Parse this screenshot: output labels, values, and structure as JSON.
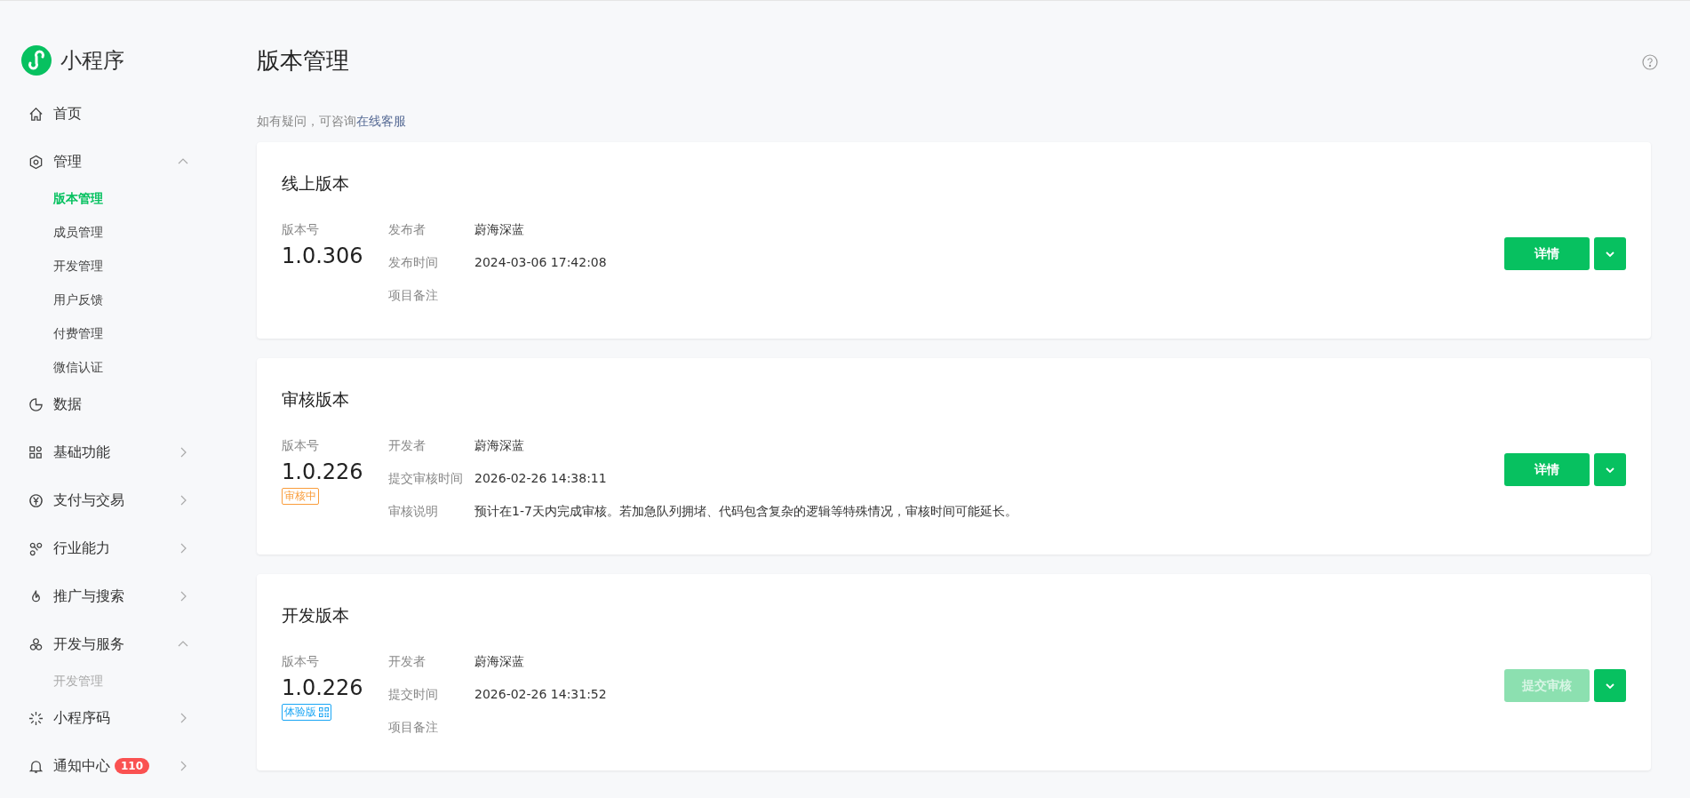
{
  "app": {
    "name": "小程序"
  },
  "sidebar": {
    "items": [
      {
        "label": "首页",
        "kind": "link"
      },
      {
        "label": "管理",
        "kind": "group",
        "expanded": true,
        "children": [
          {
            "label": "版本管理",
            "selected": true,
            "disabled": false
          },
          {
            "label": "成员管理",
            "selected": false,
            "disabled": false
          },
          {
            "label": "开发管理",
            "selected": false,
            "disabled": false
          },
          {
            "label": "用户反馈",
            "selected": false,
            "disabled": false
          },
          {
            "label": "付费管理",
            "selected": false,
            "disabled": false
          },
          {
            "label": "微信认证",
            "selected": false,
            "disabled": false
          }
        ]
      },
      {
        "label": "数据",
        "kind": "link"
      },
      {
        "label": "基础功能",
        "kind": "group",
        "expanded": false
      },
      {
        "label": "支付与交易",
        "kind": "group",
        "expanded": false
      },
      {
        "label": "行业能力",
        "kind": "group",
        "expanded": false
      },
      {
        "label": "推广与搜索",
        "kind": "group",
        "expanded": false
      },
      {
        "label": "开发与服务",
        "kind": "group",
        "expanded": true,
        "children": [
          {
            "label": "开发管理",
            "selected": false,
            "disabled": true
          }
        ]
      },
      {
        "label": "小程序码",
        "kind": "group",
        "expanded": false
      },
      {
        "label": "通知中心",
        "kind": "group",
        "expanded": false,
        "badge": "110"
      }
    ]
  },
  "page": {
    "title": "版本管理",
    "hint": "如有疑问，可咨询",
    "hint_link": "在线客服"
  },
  "cards": [
    {
      "title": "线上版本",
      "version_label": "版本号",
      "version": "1.0.306",
      "fields": [
        {
          "label": "发布者",
          "value": "蔚海深蓝"
        },
        {
          "label": "发布时间",
          "value": "2024-03-06 17:42:08"
        },
        {
          "label": "项目备注"
        }
      ],
      "button": {
        "label": "详情",
        "disabled": false
      }
    },
    {
      "title": "审核版本",
      "version_label": "版本号",
      "version": "1.0.226",
      "tag": {
        "label": "审核中",
        "kind": "review"
      },
      "fields": [
        {
          "label": "开发者",
          "value": "蔚海深蓝"
        },
        {
          "label": "提交审核时间",
          "value": "2026-02-26 14:38:11"
        },
        {
          "label": "审核说明",
          "value": "预计在1-7天内完成审核。若加急队列拥堵、代码包含复杂的逻辑等特殊情况，审核时间可能延长。"
        }
      ],
      "button": {
        "label": "详情",
        "disabled": false
      }
    },
    {
      "title": "开发版本",
      "version_label": "版本号",
      "version": "1.0.226",
      "tag": {
        "label": "体验版",
        "kind": "trial"
      },
      "fields": [
        {
          "label": "开发者",
          "value": "蔚海深蓝"
        },
        {
          "label": "提交时间",
          "value": "2026-02-26 14:31:52"
        },
        {
          "label": "项目备注"
        }
      ],
      "button": {
        "label": "提交审核",
        "disabled": true
      }
    }
  ]
}
